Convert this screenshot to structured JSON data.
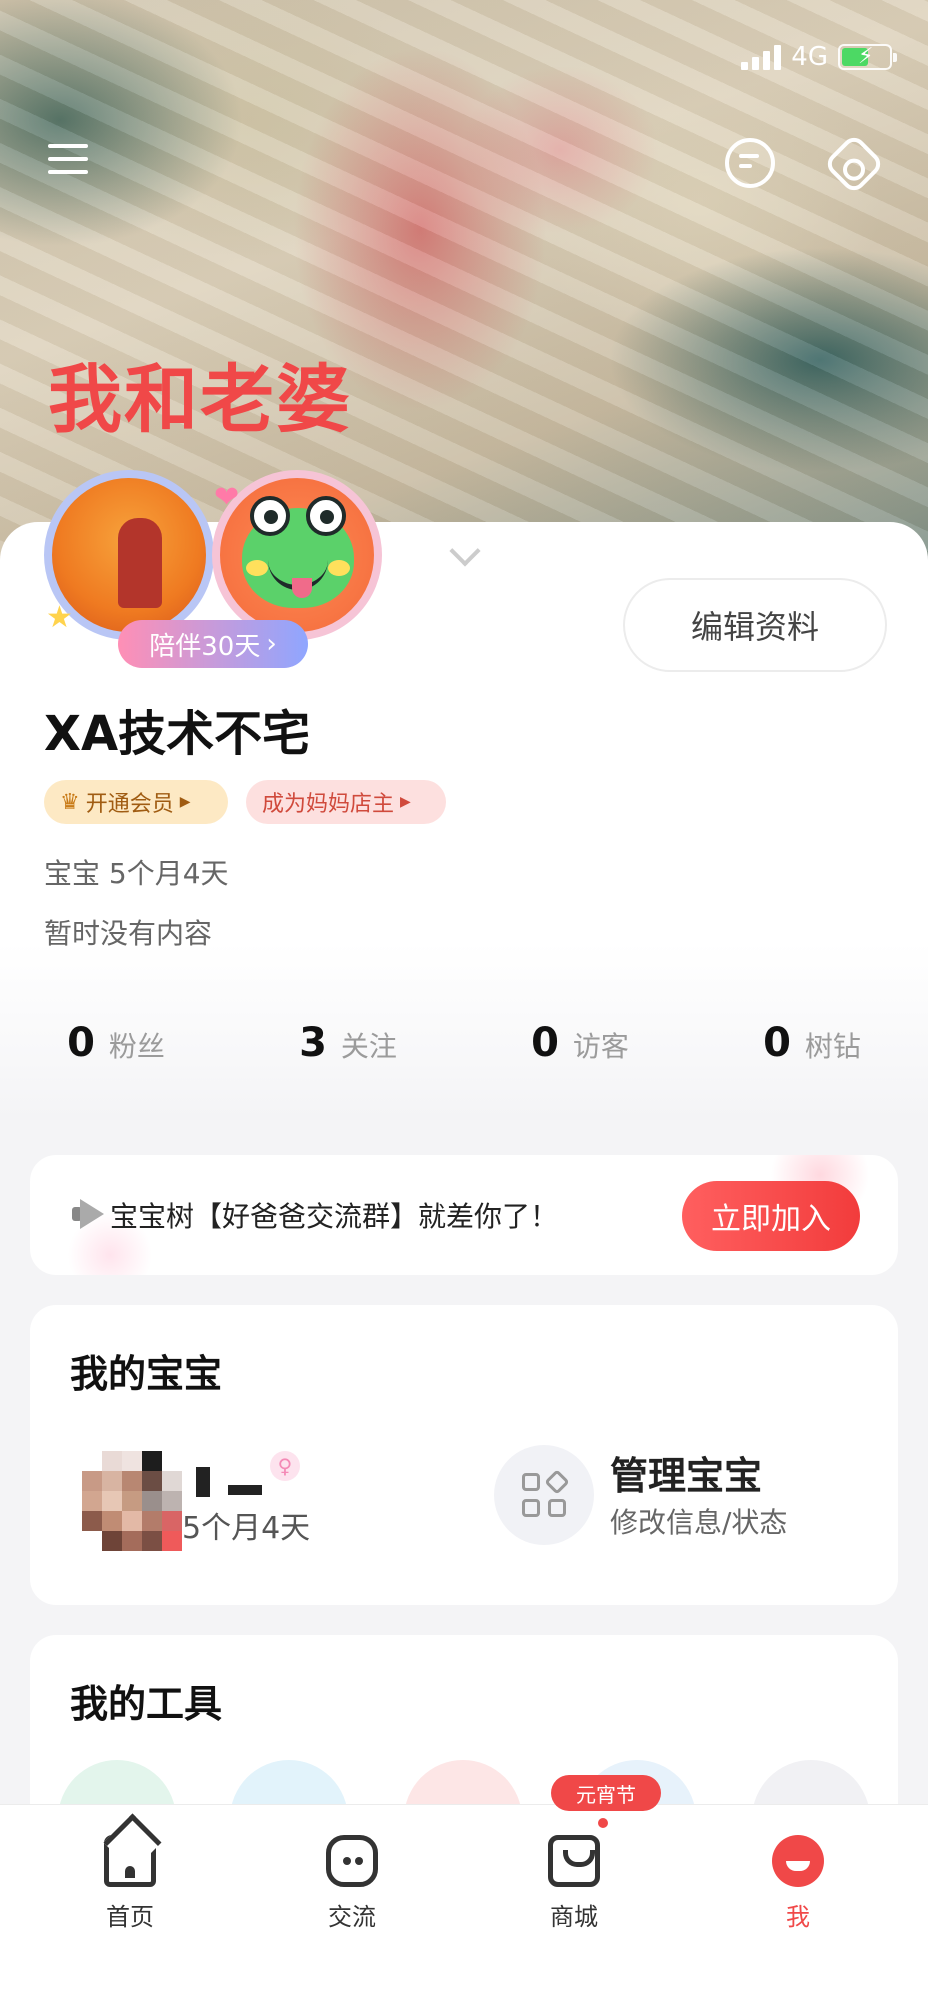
{
  "status_bar": {
    "network": "4G"
  },
  "hero": {
    "title": "我和老婆"
  },
  "profile": {
    "companion_label": "陪伴30天",
    "edit_label": "编辑资料",
    "username": "XA技术不宅",
    "badges": {
      "vip": "开通会员",
      "shop": "成为妈妈店主"
    },
    "baby_line": "宝宝  5个月4天",
    "bio": "暂时没有内容",
    "stats": [
      {
        "value": "0",
        "label": "粉丝"
      },
      {
        "value": "3",
        "label": "关注"
      },
      {
        "value": "0",
        "label": "访客"
      },
      {
        "value": "0",
        "label": "树钻"
      }
    ]
  },
  "banner": {
    "text": "宝宝树【好爸爸交流群】就差你了！",
    "button": "立即加入"
  },
  "my_baby": {
    "title": "我的宝宝",
    "baby_age": "5个月4天",
    "manage_title": "管理宝宝",
    "manage_sub": "修改信息/状态"
  },
  "my_tools": {
    "title": "我的工具",
    "festival_badge": "元宵节"
  },
  "bottom_nav": [
    {
      "label": "首页",
      "icon": "home-icon"
    },
    {
      "label": "交流",
      "icon": "chat-icon"
    },
    {
      "label": "商城",
      "icon": "shop-bag-icon"
    },
    {
      "label": "我",
      "icon": "me-icon",
      "active": true
    }
  ],
  "colors": {
    "accent": "#f04848",
    "vip_badge": "#fde9c4",
    "shop_badge": "#fde0df",
    "active_nav": "#f04848"
  }
}
